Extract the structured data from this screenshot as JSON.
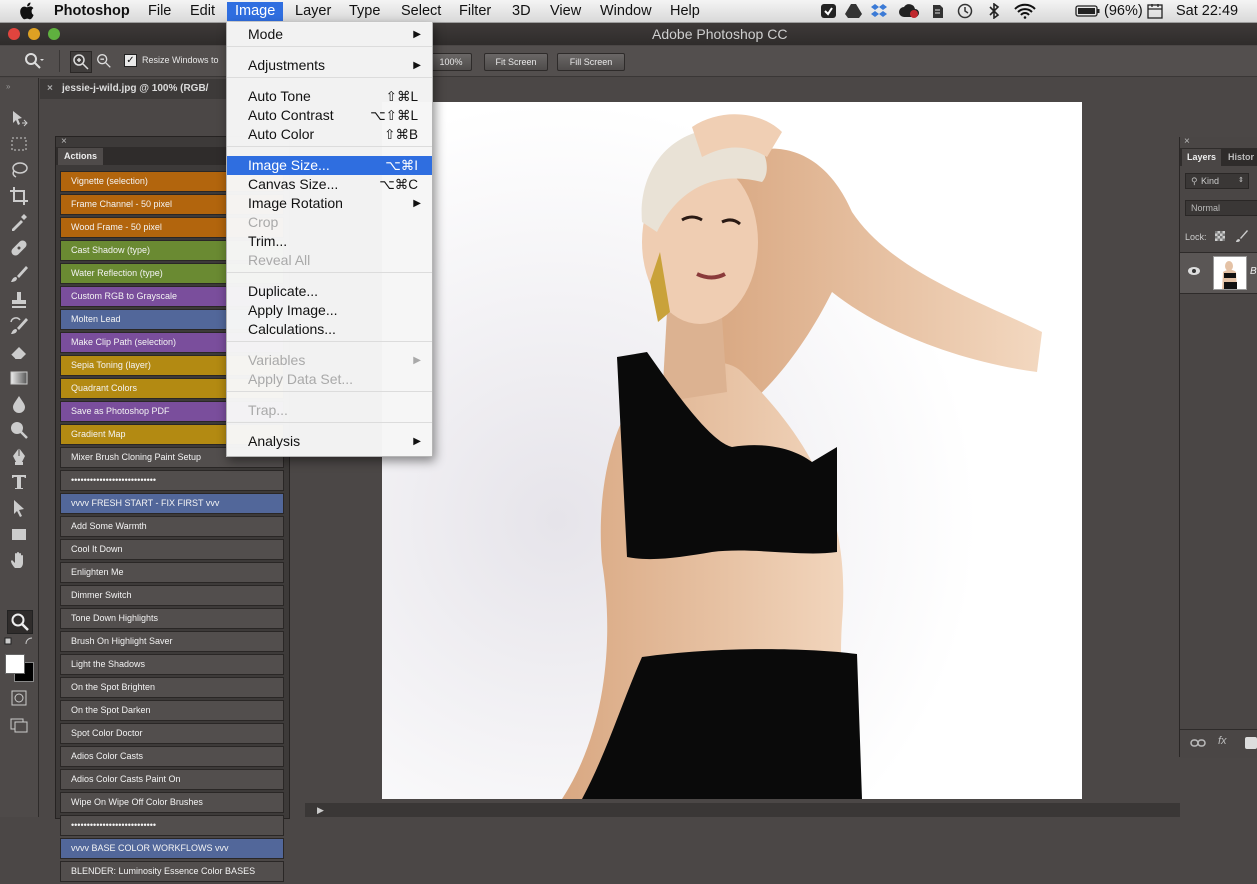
{
  "menubar": {
    "app_name": "Photoshop",
    "items": [
      "File",
      "Edit",
      "Image",
      "Layer",
      "Type",
      "Select",
      "Filter",
      "3D",
      "View",
      "Window",
      "Help"
    ],
    "active_item": "Image",
    "battery": "(96%)",
    "clock": "Sat 22:49"
  },
  "window": {
    "title": "Adobe Photoshop CC"
  },
  "options_bar": {
    "resize_label": "Resize Windows to",
    "zoom_100": "100%",
    "fit_screen": "Fit Screen",
    "fill_screen": "Fill Screen"
  },
  "document": {
    "tab_title": "jessie-j-wild.jpg @ 100% (RGB/"
  },
  "actions_panel": {
    "tab_label": "Actions",
    "items": [
      {
        "label": "Vignette (selection)",
        "color": "#b2650d"
      },
      {
        "label": "Frame Channel - 50 pixel",
        "color": "#b2650d"
      },
      {
        "label": "Wood Frame - 50 pixel",
        "color": "#b2650d"
      },
      {
        "label": "Cast Shadow (type)",
        "color": "#6a8a32"
      },
      {
        "label": "Water Reflection (type)",
        "color": "#6a8a32"
      },
      {
        "label": "Custom RGB to Grayscale",
        "color": "#7a4e9c"
      },
      {
        "label": "Molten Lead",
        "color": "#52679a"
      },
      {
        "label": "Make Clip Path (selection)",
        "color": "#7a4e9c"
      },
      {
        "label": "Sepia Toning (layer)",
        "color": "#b38a12"
      },
      {
        "label": "Quadrant Colors",
        "color": "#b38a12"
      },
      {
        "label": "Save as Photoshop PDF",
        "color": "#7a4e9c"
      },
      {
        "label": "Gradient Map",
        "color": "#b38a12"
      },
      {
        "label": "Mixer Brush Cloning Paint Setup",
        "color": "#524e4d"
      },
      {
        "label": "•••••••••••••••••••••••••••",
        "color": "#524e4d"
      },
      {
        "label": "vvvv  FRESH START - FIX FIRST  vvv",
        "color": "#52679a"
      },
      {
        "label": "Add Some Warmth",
        "color": "#524e4d"
      },
      {
        "label": "Cool It Down",
        "color": "#524e4d"
      },
      {
        "label": "Enlighten Me",
        "color": "#524e4d"
      },
      {
        "label": "Dimmer Switch",
        "color": "#524e4d"
      },
      {
        "label": "Tone Down Highlights",
        "color": "#524e4d"
      },
      {
        "label": "Brush On Highlight Saver",
        "color": "#524e4d"
      },
      {
        "label": "Light the Shadows",
        "color": "#524e4d"
      },
      {
        "label": "On the Spot Brighten",
        "color": "#524e4d"
      },
      {
        "label": "On the Spot Darken",
        "color": "#524e4d"
      },
      {
        "label": "Spot Color Doctor",
        "color": "#524e4d"
      },
      {
        "label": "Adios Color Casts",
        "color": "#524e4d"
      },
      {
        "label": "Adios Color Casts Paint On",
        "color": "#524e4d"
      },
      {
        "label": "Wipe On Wipe Off Color Brushes",
        "color": "#524e4d"
      },
      {
        "label": "•••••••••••••••••••••••••••",
        "color": "#524e4d"
      },
      {
        "label": "vvvv  BASE COLOR WORKFLOWS  vvv",
        "color": "#52679a"
      },
      {
        "label": "BLENDER: Luminosity Essence Color BASES",
        "color": "#524e4d"
      }
    ]
  },
  "image_menu": {
    "items": [
      {
        "label": "Mode",
        "shortcut": "",
        "submenu": true,
        "disabled": false
      },
      {
        "label": "Adjustments",
        "shortcut": "",
        "submenu": true,
        "disabled": false
      },
      {
        "label": "Auto Tone",
        "shortcut": "⇧⌘L",
        "submenu": false,
        "disabled": false
      },
      {
        "label": "Auto Contrast",
        "shortcut": "⌥⇧⌘L",
        "submenu": false,
        "disabled": false
      },
      {
        "label": "Auto Color",
        "shortcut": "⇧⌘B",
        "submenu": false,
        "disabled": false
      },
      {
        "label": "Image Size...",
        "shortcut": "⌥⌘I",
        "submenu": false,
        "disabled": false,
        "highlighted": true
      },
      {
        "label": "Canvas Size...",
        "shortcut": "⌥⌘C",
        "submenu": false,
        "disabled": false
      },
      {
        "label": "Image Rotation",
        "shortcut": "",
        "submenu": true,
        "disabled": false
      },
      {
        "label": "Crop",
        "shortcut": "",
        "submenu": false,
        "disabled": true
      },
      {
        "label": "Trim...",
        "shortcut": "",
        "submenu": false,
        "disabled": false
      },
      {
        "label": "Reveal All",
        "shortcut": "",
        "submenu": false,
        "disabled": true
      },
      {
        "label": "Duplicate...",
        "shortcut": "",
        "submenu": false,
        "disabled": false
      },
      {
        "label": "Apply Image...",
        "shortcut": "",
        "submenu": false,
        "disabled": false
      },
      {
        "label": "Calculations...",
        "shortcut": "",
        "submenu": false,
        "disabled": false
      },
      {
        "label": "Variables",
        "shortcut": "",
        "submenu": true,
        "disabled": true
      },
      {
        "label": "Apply Data Set...",
        "shortcut": "",
        "submenu": false,
        "disabled": true
      },
      {
        "label": "Trap...",
        "shortcut": "",
        "submenu": false,
        "disabled": true
      },
      {
        "label": "Analysis",
        "shortcut": "",
        "submenu": true,
        "disabled": false
      }
    ]
  },
  "layers_panel": {
    "tabs": [
      "Layers",
      "Histor"
    ],
    "kind_label": "Kind",
    "blend_mode": "Normal",
    "lock_label": "Lock:",
    "layer_name": "B",
    "fx_label": "fx"
  },
  "colors": {
    "menu_highlight": "#2f6ee0",
    "canvas_bg": "#4b4746"
  }
}
